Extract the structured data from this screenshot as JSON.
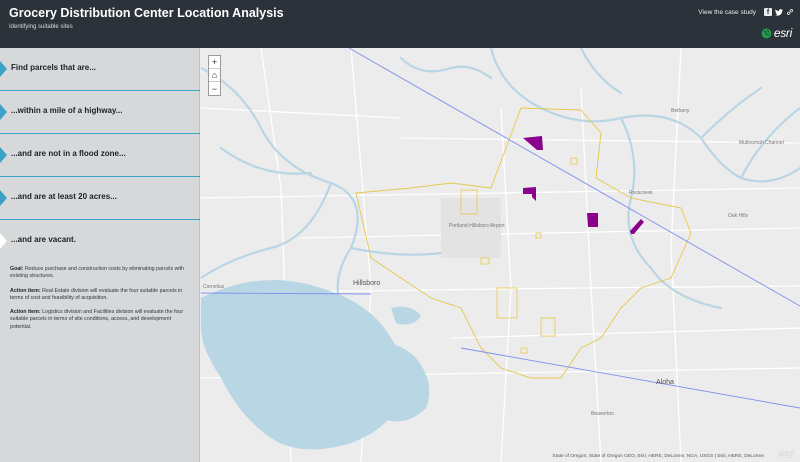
{
  "header": {
    "title": "Grocery Distribution Center Location Analysis",
    "subtitle": "Identifying suitable sites",
    "case_study_link": "View the case study",
    "logo": "esri"
  },
  "sidebar": {
    "steps": [
      {
        "label": "Find parcels that are...",
        "active": false
      },
      {
        "label": "...within a mile of a highway...",
        "active": false
      },
      {
        "label": "...and are not in a flood zone...",
        "active": false
      },
      {
        "label": "...and are at least 20 acres...",
        "active": false
      },
      {
        "label": "...and are vacant.",
        "active": true
      }
    ],
    "details": {
      "goal_label": "Goal:",
      "goal_text": "Reduce purchase and construction costs by eliminating parcels with existing structures.",
      "action1_label": "Action item:",
      "action1_text": "Real Estate division will evaluate the four suitable parcels in terms of cost and feasibility of acquisition.",
      "action2_label": "Action item:",
      "action2_text": "Logistics division and Facilities division will evaluate the four suitable parcels in terms of site conditions, access, and development potential."
    }
  },
  "map": {
    "zoom_in": "+",
    "home": "⌂",
    "zoom_out": "−",
    "labels": {
      "hillsboro": "Hillsboro",
      "aloha": "Aloha",
      "rockcreek": "Rockcreek",
      "oak_hills": "Oak Hills",
      "airport": "Portland-Hillsboro Airport",
      "cornelius": "Cornelius",
      "multnomah": "Multnomah Channel",
      "bethany": "Bethany",
      "beaverton": "Beaverton"
    },
    "attribution": "State of Oregon, State of Oregon GEO, Esri, HERE, DeLorme, NGA, USGS | Esri, HERE, DeLorme",
    "logo": "esri",
    "colors": {
      "water": "#b9d6e4",
      "study_boundary": "#e6c84a",
      "suitable_parcel": "#8b008b",
      "highway": "#7c8ff0"
    }
  }
}
